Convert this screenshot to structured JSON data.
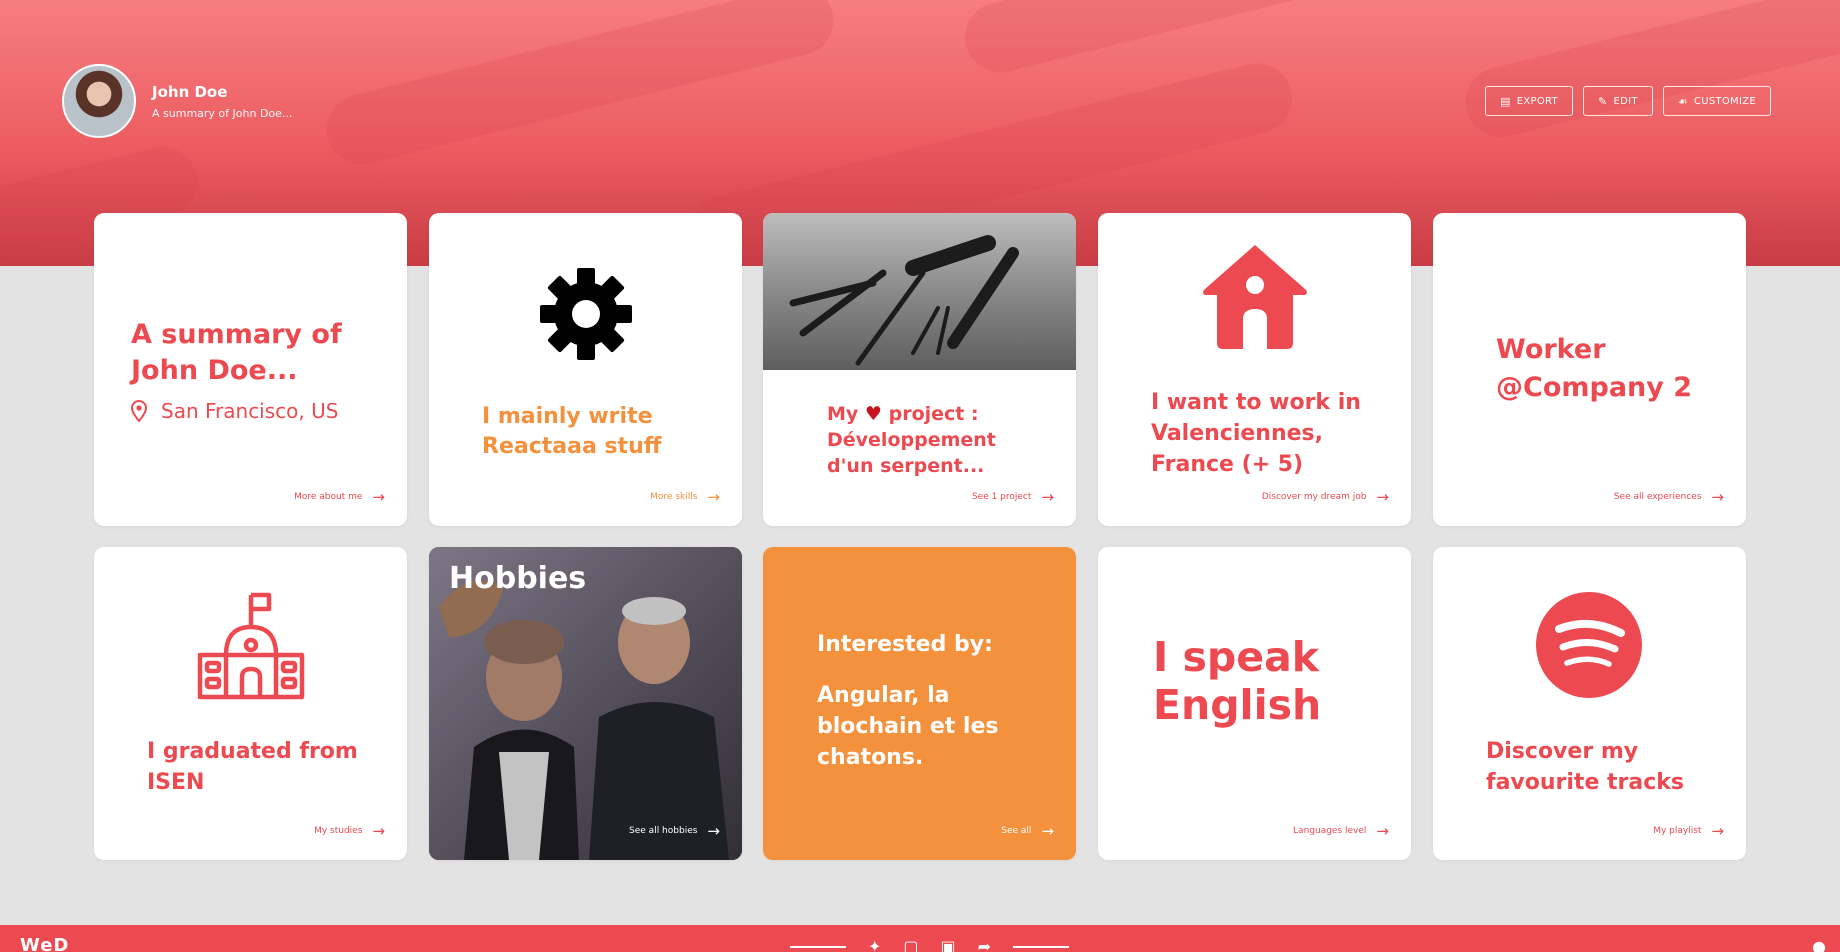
{
  "colors": {
    "accent": "#ec4a50",
    "orange": "#f3913d",
    "background": "#e3e3e3"
  },
  "header": {
    "name": "John Doe",
    "summary": "A summary of John Doe...",
    "actions": [
      {
        "label": "EXPORT",
        "icon": "document-icon"
      },
      {
        "label": "EDIT",
        "icon": "pencil-icon"
      },
      {
        "label": "CUSTOMIZE",
        "icon": "paint-icon"
      }
    ]
  },
  "cards": {
    "about": {
      "title": "A summary of John Doe...",
      "location": "San Francisco, US",
      "link": "More about me"
    },
    "skills": {
      "title": "I mainly write Reactaaa stuff",
      "link": "More skills"
    },
    "projects": {
      "title_prefix": "My",
      "title_suffix": "project : Développement d'un serpent...",
      "link": "See 1 project"
    },
    "dream_job": {
      "title": "I want to work in Valenciennes, France (+ 5)",
      "link": "Discover my dream job"
    },
    "experiences": {
      "title": "Worker @Company 2",
      "link": "See all experiences"
    },
    "studies": {
      "title": "I graduated from ISEN",
      "link": "My studies"
    },
    "hobbies": {
      "title": "Hobbies",
      "link": "See all hobbies"
    },
    "interests": {
      "heading": "Interested by:",
      "text": "Angular, la blochain et les chatons.",
      "link": "See all"
    },
    "languages": {
      "title": "I speak English",
      "link": "Languages level"
    },
    "music": {
      "title": "Discover my favourite tracks",
      "link": "My playlist"
    }
  },
  "footer": {
    "logo": "WeD"
  }
}
